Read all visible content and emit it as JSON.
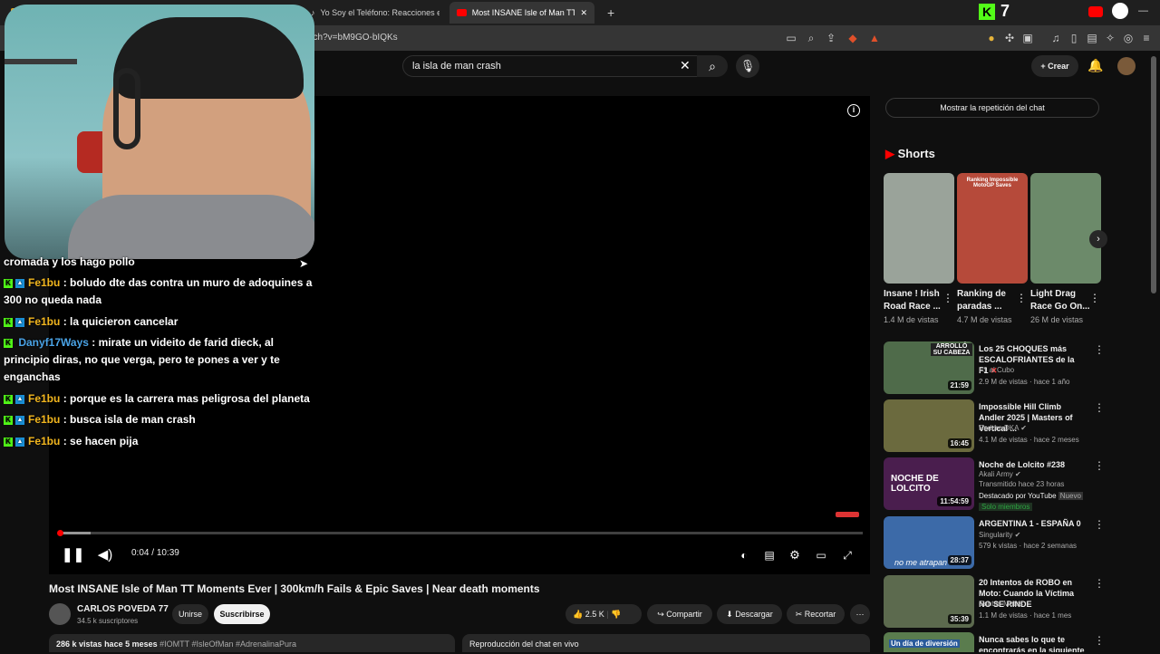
{
  "browser": {
    "tabs": [
      {
        "label": "C"
      },
      {
        "label": "Yo Soy el Teléfono: Reacciones en Re"
      },
      {
        "label": "Most INSANE Isle of Man TT Mo"
      }
    ],
    "url": "watch?v=bM9GO-bIQKs"
  },
  "header": {
    "search_value": "la isla de man crash",
    "create_label": "Crear"
  },
  "chat_overlay": {
    "lines": [
      {
        "user": "",
        "text": "cromada y los hago pollo"
      },
      {
        "user": "Fe1bu",
        "text": ": boludo dte das contra un muro de adoquines a 300 no queda nada"
      },
      {
        "user": "Fe1bu",
        "text": ": la quicieron cancelar"
      },
      {
        "user": "Danyf17Ways",
        "text": ": mirate un videito de farid dieck, al principio diras, no que verga, pero te pones a ver y te enganchas"
      },
      {
        "user": "Fe1bu",
        "text": ": porque es la carrera mas peligrosa del planeta"
      },
      {
        "user": "Fe1bu",
        "text": ": busca isla de man crash"
      },
      {
        "user": "Fe1bu",
        "text": ": se hacen pija"
      }
    ]
  },
  "player": {
    "time_current": "0:04",
    "time_sep": " / ",
    "time_total": "10:39",
    "progress_fraction": 0.006,
    "buffer_fraction": 0.04
  },
  "video": {
    "title": "Most INSANE Isle of Man TT Moments Ever | 300km/h Fails & Epic Saves | Near death moments",
    "channel": "CARLOS POVEDA 77",
    "subscribers": "34.5 k suscriptores",
    "join_label": "Unirse",
    "subscribe_label": "Suscribirse",
    "likes": "2.5 K",
    "share_label": "Compartir",
    "download_label": "Descargar",
    "clip_label": "Recortar",
    "views": "286 k vistas",
    "age": "hace 5 meses",
    "tags": "#IOMTT #IsleOfMan #AdrenalinaPura",
    "chat_replay_bar": "Reproducción del chat en vivo"
  },
  "sidebar": {
    "chat_replay_button": "Mostrar la repetición del chat",
    "shorts_heading": "Shorts",
    "shorts": [
      {
        "title": "Insane ! Irish Road Race ...",
        "views": "1.4 M de vistas",
        "color": "#9aa39a"
      },
      {
        "title": "Ranking de paradas ...",
        "views": "4.7 M de vistas",
        "color": "#b64a3a",
        "overlay": "Ranking Impossible MotoGP Saves"
      },
      {
        "title": "Light Drag Race Go On...",
        "views": "26 M de vistas",
        "color": "#6c8a6a"
      }
    ],
    "recommended": [
      {
        "title": "Los 25 CHOQUES más ESCALOFRIANTES de la F1",
        "channel": "F1 al Cubo",
        "meta": "2.9 M de vistas · hace 1 año",
        "duration": "21:59",
        "color": "#4f6b4a",
        "thumb_text": "ARROLLÓ SU CABEZA"
      },
      {
        "title": "Impossible Hill Climb Andler 2025 | Masters of Vertical ...",
        "channel": "Enduro DKA",
        "meta": "4.1 M de vistas · hace 2 meses",
        "duration": "16:45",
        "color": "#6b6a3e",
        "thumb_text": ""
      },
      {
        "title": "Noche de Lolcito #238",
        "channel": "Akali Army",
        "meta": "Transmitido hace 23 horas",
        "extra": "Destacado por YouTube",
        "new": "Nuevo",
        "members": "Solo miembros",
        "duration": "11:54:59",
        "color": "#4a1e4e",
        "thumb_text": "NOCHE DE LOLCITO"
      },
      {
        "title": "ARGENTINA 1 - ESPAÑA 0",
        "channel": "Singularity",
        "meta": "579 k vistas · hace 2 semanas",
        "duration": "28:37",
        "color": "#3c6aa8",
        "thumb_text": "no me atrapan"
      },
      {
        "title": "20 Intentos de ROBO en Moto: Cuando la Víctima NO SE RINDE",
        "channel": "Santas Motos",
        "meta": "1.1 M de vistas · hace 1 mes",
        "duration": "35:39",
        "color": "#5c6a4e",
        "thumb_text": ""
      },
      {
        "title": "Nunca sabes lo que te encontrarás en la siguiente ...",
        "channel": "",
        "meta": "",
        "duration": "",
        "color": "#5a7c4e",
        "thumb_text": "Un día de diversión"
      }
    ]
  },
  "colors": {
    "accent": "#ff0000",
    "kick": "#53fc18"
  }
}
